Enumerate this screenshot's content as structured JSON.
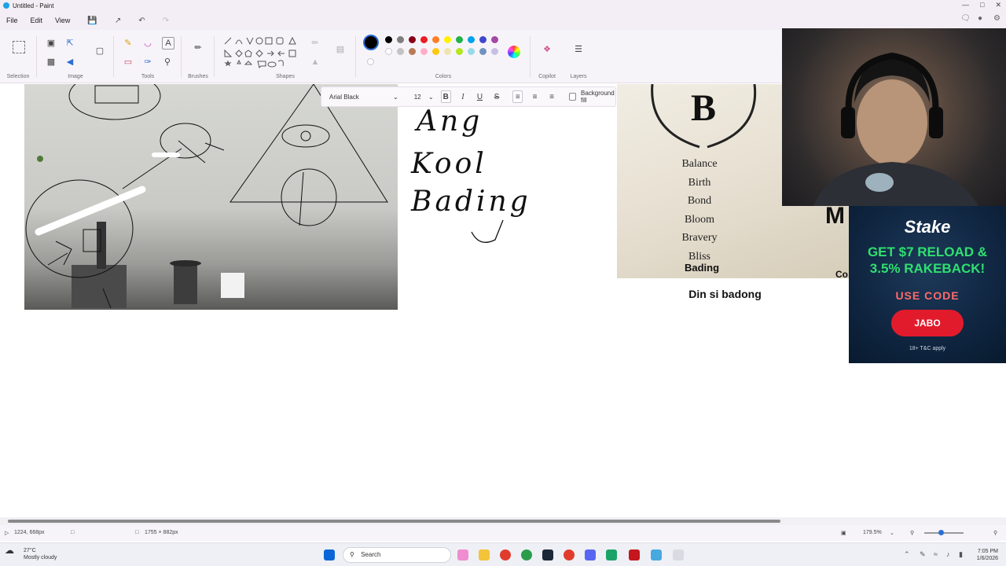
{
  "window": {
    "title": "Untitled - Paint"
  },
  "menu": {
    "file": "File",
    "edit": "Edit",
    "view": "View"
  },
  "ribbon": {
    "groups": {
      "selection": "Selection",
      "image": "Image",
      "tools": "Tools",
      "brushes": "Brushes",
      "shapes": "Shapes",
      "colors": "Colors",
      "copilot": "Copilot",
      "layers": "Layers"
    },
    "palette_row1": [
      "#000000",
      "#7f7f7f",
      "#880015",
      "#ed1c24",
      "#ff7f27",
      "#fff200",
      "#22b14c",
      "#00a2e8",
      "#3f48cc",
      "#a349a4"
    ],
    "palette_row2": [
      "#ffffff",
      "#c3c3c3",
      "#b97a57",
      "#ffaec9",
      "#ffc90e",
      "#efe4b0",
      "#b5e61d",
      "#99d9ea",
      "#7092be",
      "#c8bfe7"
    ],
    "primary_color": "#000000"
  },
  "textformat": {
    "font": "Arial Black",
    "size": "12",
    "bold": "B",
    "italic": "I",
    "underline": "U",
    "strike": "S",
    "background_fill": "Background fill"
  },
  "canvas": {
    "handwritten_lines": [
      "Ang",
      "Kool",
      "Bading"
    ],
    "book_words": [
      "Balance",
      "Birth",
      "Bond",
      "Bloom",
      "Bravery",
      "Bliss"
    ],
    "book_bading": "Bading",
    "book_letter": "B",
    "caption": "Din si badong",
    "overlay_m": "M",
    "overlay_co": "Co"
  },
  "ad": {
    "brand": "Stake",
    "promo_line1": "GET $7 RELOAD &",
    "promo_line2": "3.5% RAKEBACK!",
    "use_code": "USE CODE",
    "code": "JABO",
    "terms": "18+ T&C apply"
  },
  "status": {
    "cursor_pos": "1224, 668px",
    "canvas_size": "1755 × 882px",
    "zoom": "179.5%"
  },
  "taskbar": {
    "weather_temp": "27°C",
    "weather_desc": "Mostly cloudy",
    "search_placeholder": "Search",
    "time": "7:05 PM",
    "date": "1/6/2026"
  }
}
